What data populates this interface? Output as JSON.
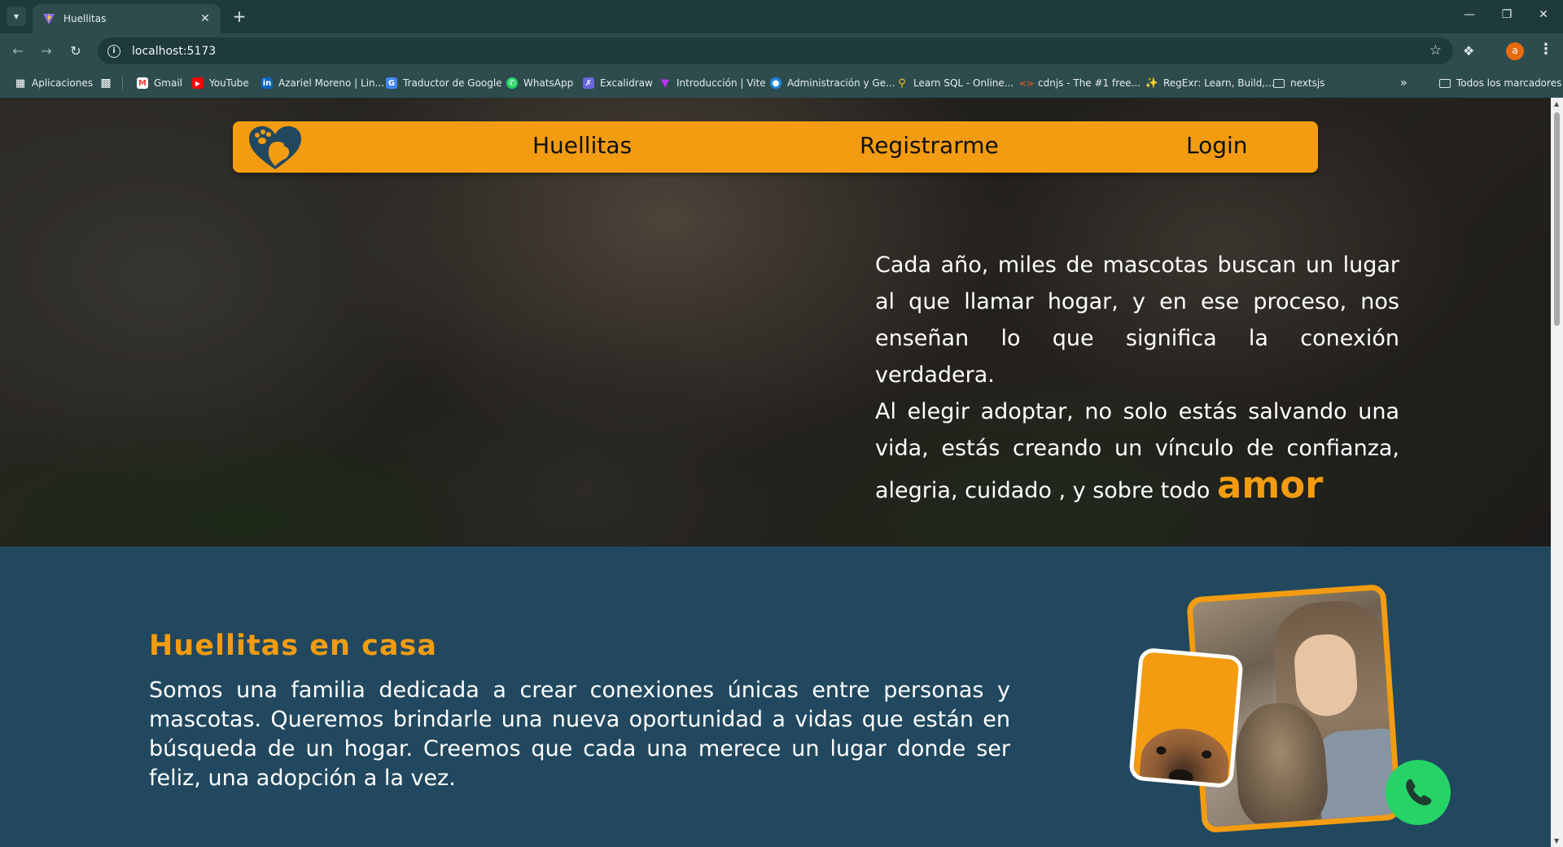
{
  "browser": {
    "tab_title": "Huellitas",
    "url": "localhost:5173",
    "profile_initial": "a"
  },
  "bookmarks": {
    "apps_label": "Aplicaciones",
    "items": [
      {
        "label": "Gmail",
        "icon": "gmail-icon",
        "color": "#ea4335"
      },
      {
        "label": "YouTube",
        "icon": "youtube-icon",
        "color": "#ff0000"
      },
      {
        "label": "Azariel Moreno | Lin...",
        "icon": "linkedin-icon",
        "color": "#0a66c2"
      },
      {
        "label": "Traductor de Google",
        "icon": "google-translate-icon",
        "color": "#4285f4"
      },
      {
        "label": "WhatsApp",
        "icon": "whatsapp-icon",
        "color": "#25d366"
      },
      {
        "label": "Excalidraw",
        "icon": "excalidraw-icon",
        "color": "#6965db"
      },
      {
        "label": "Introducción | Vite",
        "icon": "vite-icon",
        "color": "#bd34fe"
      },
      {
        "label": "Administración y Ge...",
        "icon": "admin-icon",
        "color": "#1e88e5"
      },
      {
        "label": "Learn SQL - Online...",
        "icon": "sql-icon",
        "color": "#f4c20d"
      },
      {
        "label": "cdnjs - The #1 free...",
        "icon": "cdnjs-icon",
        "color": "#e95420"
      },
      {
        "label": "RegExr: Learn, Build,...",
        "icon": "regexr-icon",
        "color": "#70b0e0"
      },
      {
        "label": "nextsjs",
        "icon": "folder-icon",
        "color": "#dfe7e7"
      }
    ],
    "all_bookmarks_label": "Todos los marcadores"
  },
  "navbar": {
    "brand": "Huellitas",
    "register": "Registrarme",
    "login": "Login",
    "logo_icon": "heart-paw-dog-logo"
  },
  "hero": {
    "paragraph1": "Cada año, miles de mascotas buscan un lugar al que llamar hogar, y en ese proceso, nos enseñan lo que significa la conexión verdadera.",
    "paragraph2": "Al elegir adoptar, no solo estás salvando una vida, estás creando un vínculo de confianza, alegria, cuidado , y sobre todo",
    "highlight": "amor"
  },
  "about": {
    "title": "Huellitas en casa",
    "text": "Somos una familia dedicada a crear conexiones únicas entre personas y mascotas. Queremos brindarle una nueva oportunidad a vidas que están en búsqueda de un hogar. Creemos que cada una merece un lugar donde ser feliz, una adopción a la vez."
  },
  "colors": {
    "accent": "#f39c12",
    "section_bg": "#21485e",
    "whatsapp": "#25d366"
  }
}
